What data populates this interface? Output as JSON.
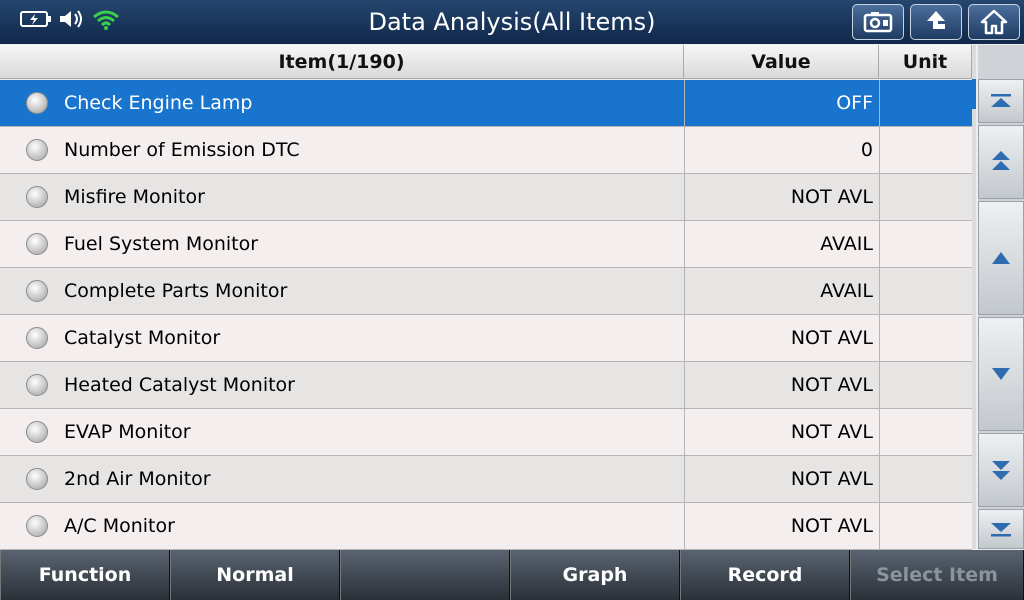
{
  "header": {
    "title": "Data Analysis(All Items)"
  },
  "status": {
    "icons": [
      "battery-charging-icon",
      "speaker-icon",
      "wifi-icon"
    ]
  },
  "top_buttons": [
    "screenshot-icon",
    "back-icon",
    "home-icon"
  ],
  "table": {
    "columns": {
      "item": "Item(1/190)",
      "value": "Value",
      "unit": "Unit"
    },
    "rows": [
      {
        "name": "Check Engine Lamp",
        "value": "OFF",
        "unit": "",
        "selected": true
      },
      {
        "name": "Number of Emission DTC",
        "value": "0",
        "unit": ""
      },
      {
        "name": "Misfire Monitor",
        "value": "NOT AVL",
        "unit": ""
      },
      {
        "name": "Fuel System Monitor",
        "value": "AVAIL",
        "unit": ""
      },
      {
        "name": "Complete Parts Monitor",
        "value": "AVAIL",
        "unit": ""
      },
      {
        "name": "Catalyst Monitor",
        "value": "NOT AVL",
        "unit": ""
      },
      {
        "name": "Heated Catalyst Monitor",
        "value": "NOT AVL",
        "unit": ""
      },
      {
        "name": "EVAP Monitor",
        "value": "NOT AVL",
        "unit": ""
      },
      {
        "name": "2nd Air Monitor",
        "value": "NOT AVL",
        "unit": ""
      },
      {
        "name": "A/C Monitor",
        "value": "NOT AVL",
        "unit": ""
      }
    ]
  },
  "nav_buttons": [
    "scroll-top-icon",
    "page-up-icon",
    "scroll-up-icon",
    "scroll-down-icon",
    "page-down-icon",
    "scroll-bottom-icon"
  ],
  "function_bar": {
    "function": "Function",
    "normal": "Normal",
    "empty": "",
    "graph": "Graph",
    "record": "Record",
    "select_item": "Select Item"
  },
  "colors": {
    "selected_row": "#1874cd",
    "header_bar": "#1a3558",
    "wifi": "#37d14a"
  }
}
